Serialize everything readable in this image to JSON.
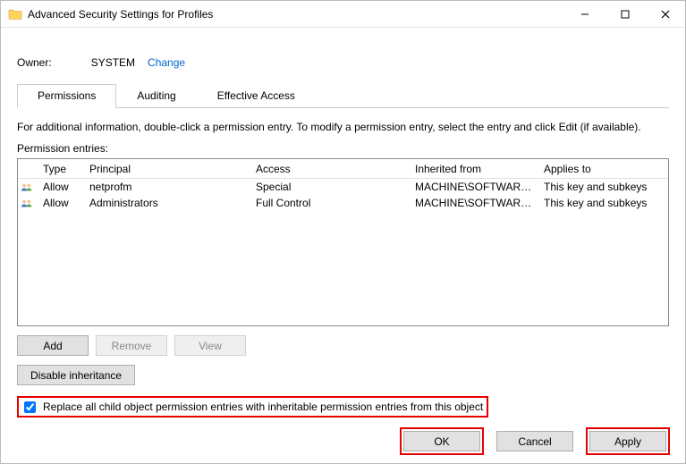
{
  "window": {
    "title": "Advanced Security Settings for Profiles"
  },
  "owner": {
    "label": "Owner:",
    "value": "SYSTEM",
    "change": "Change"
  },
  "tabs": {
    "permissions": "Permissions",
    "auditing": "Auditing",
    "effective": "Effective Access"
  },
  "info": "For additional information, double-click a permission entry. To modify a permission entry, select the entry and click Edit (if available).",
  "entries_label": "Permission entries:",
  "columns": {
    "type": "Type",
    "principal": "Principal",
    "access": "Access",
    "inherited": "Inherited from",
    "applies": "Applies to"
  },
  "rows": [
    {
      "type": "Allow",
      "principal": "netprofm",
      "access": "Special",
      "inherited": "MACHINE\\SOFTWARE...",
      "applies": "This key and subkeys"
    },
    {
      "type": "Allow",
      "principal": "Administrators",
      "access": "Full Control",
      "inherited": "MACHINE\\SOFTWARE...",
      "applies": "This key and subkeys"
    }
  ],
  "buttons": {
    "add": "Add",
    "remove": "Remove",
    "view": "View",
    "disable_inh": "Disable inheritance"
  },
  "replace": {
    "label": "Replace all child object permission entries with inheritable permission entries from this object",
    "checked": true
  },
  "footer": {
    "ok": "OK",
    "cancel": "Cancel",
    "apply": "Apply"
  }
}
